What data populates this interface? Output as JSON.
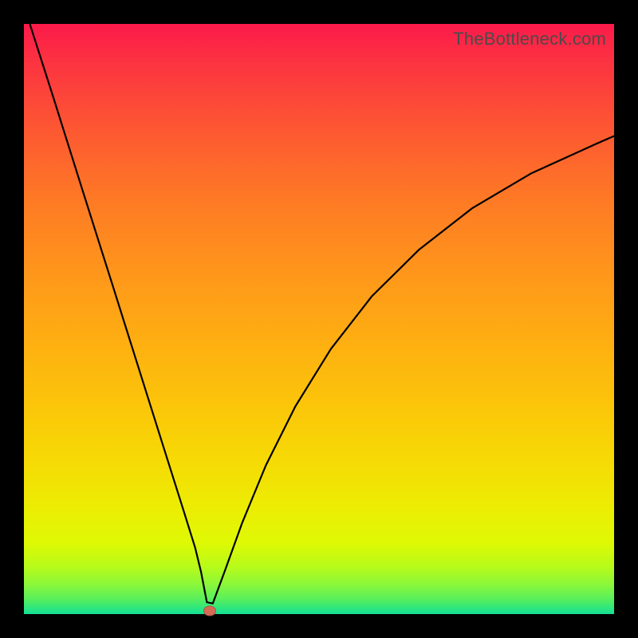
{
  "watermark": "TheBottleneck.com",
  "marker": {
    "x_frac": 0.315,
    "y_frac": 0.994
  },
  "colors": {
    "curve": "#000000",
    "marker": "#d56a55",
    "frame": "#000000"
  },
  "chart_data": {
    "type": "line",
    "title": "",
    "xlabel": "",
    "ylabel": "",
    "xlim": [
      0,
      1
    ],
    "ylim": [
      0,
      1
    ],
    "note": "No axis ticks or labels are rendered; values are fractional positions within the plot area. y increases upward.",
    "series": [
      {
        "name": "curve",
        "x": [
          0.01,
          0.05,
          0.1,
          0.15,
          0.2,
          0.24,
          0.27,
          0.29,
          0.3,
          0.31,
          0.32,
          0.34,
          0.37,
          0.41,
          0.46,
          0.52,
          0.59,
          0.67,
          0.76,
          0.86,
          0.97,
          1.0
        ],
        "y": [
          1.0,
          0.875,
          0.716,
          0.558,
          0.399,
          0.272,
          0.177,
          0.113,
          0.072,
          0.02,
          0.018,
          0.072,
          0.155,
          0.252,
          0.352,
          0.449,
          0.539,
          0.618,
          0.688,
          0.747,
          0.797,
          0.81
        ]
      }
    ],
    "annotations": [
      {
        "type": "point",
        "x": 0.315,
        "y": 0.006,
        "label": "minimum marker"
      }
    ]
  }
}
